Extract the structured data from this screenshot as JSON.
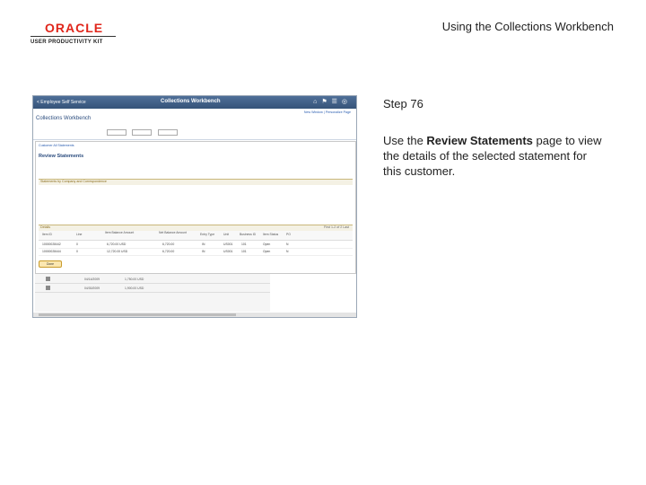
{
  "logo": {
    "brand": "ORACLE",
    "product": "USER PRODUCTIVITY KIT"
  },
  "slide_title": "Using the Collections Workbench",
  "step": {
    "label": "Step 76",
    "text_before": "Use the ",
    "text_bold": "Review Statements",
    "text_after": " page to view the details of the selected statement for this customer."
  },
  "screenshot": {
    "nav_back": "< Employee Self Service",
    "header_title": "Collections Workbench",
    "header_links": "New Window | Personalize Page",
    "page_title": "Collections Workbench",
    "crumb": "Customer All Statements",
    "review_title": "Review Statements",
    "group_bar": "Statements by Company and Correspondence",
    "grid_title": "Details",
    "grid_nav": "First  1-2 of 2  Last",
    "detail_button": "Done",
    "grid_columns": [
      "Item ID",
      "Line",
      "Item Balance Amount",
      "Net Balance Amount",
      "Entry Type",
      "Unit",
      "Business ID",
      "Item Status",
      "PO"
    ],
    "grid_rows": [
      [
        "10000028442",
        "0",
        "6,720.00 USD",
        "6,720.00",
        "IN",
        "US001",
        "101",
        "Open",
        "N"
      ],
      [
        "10000028444",
        "0",
        "12,720.00 USD",
        "6,720.00",
        "IN",
        "US001",
        "101",
        "Open",
        "N"
      ]
    ],
    "lower_rows": [
      [
        "04/14/2009",
        "1,750.00 USD"
      ],
      [
        "04/30/2009",
        "1,900.00 USD"
      ]
    ]
  }
}
